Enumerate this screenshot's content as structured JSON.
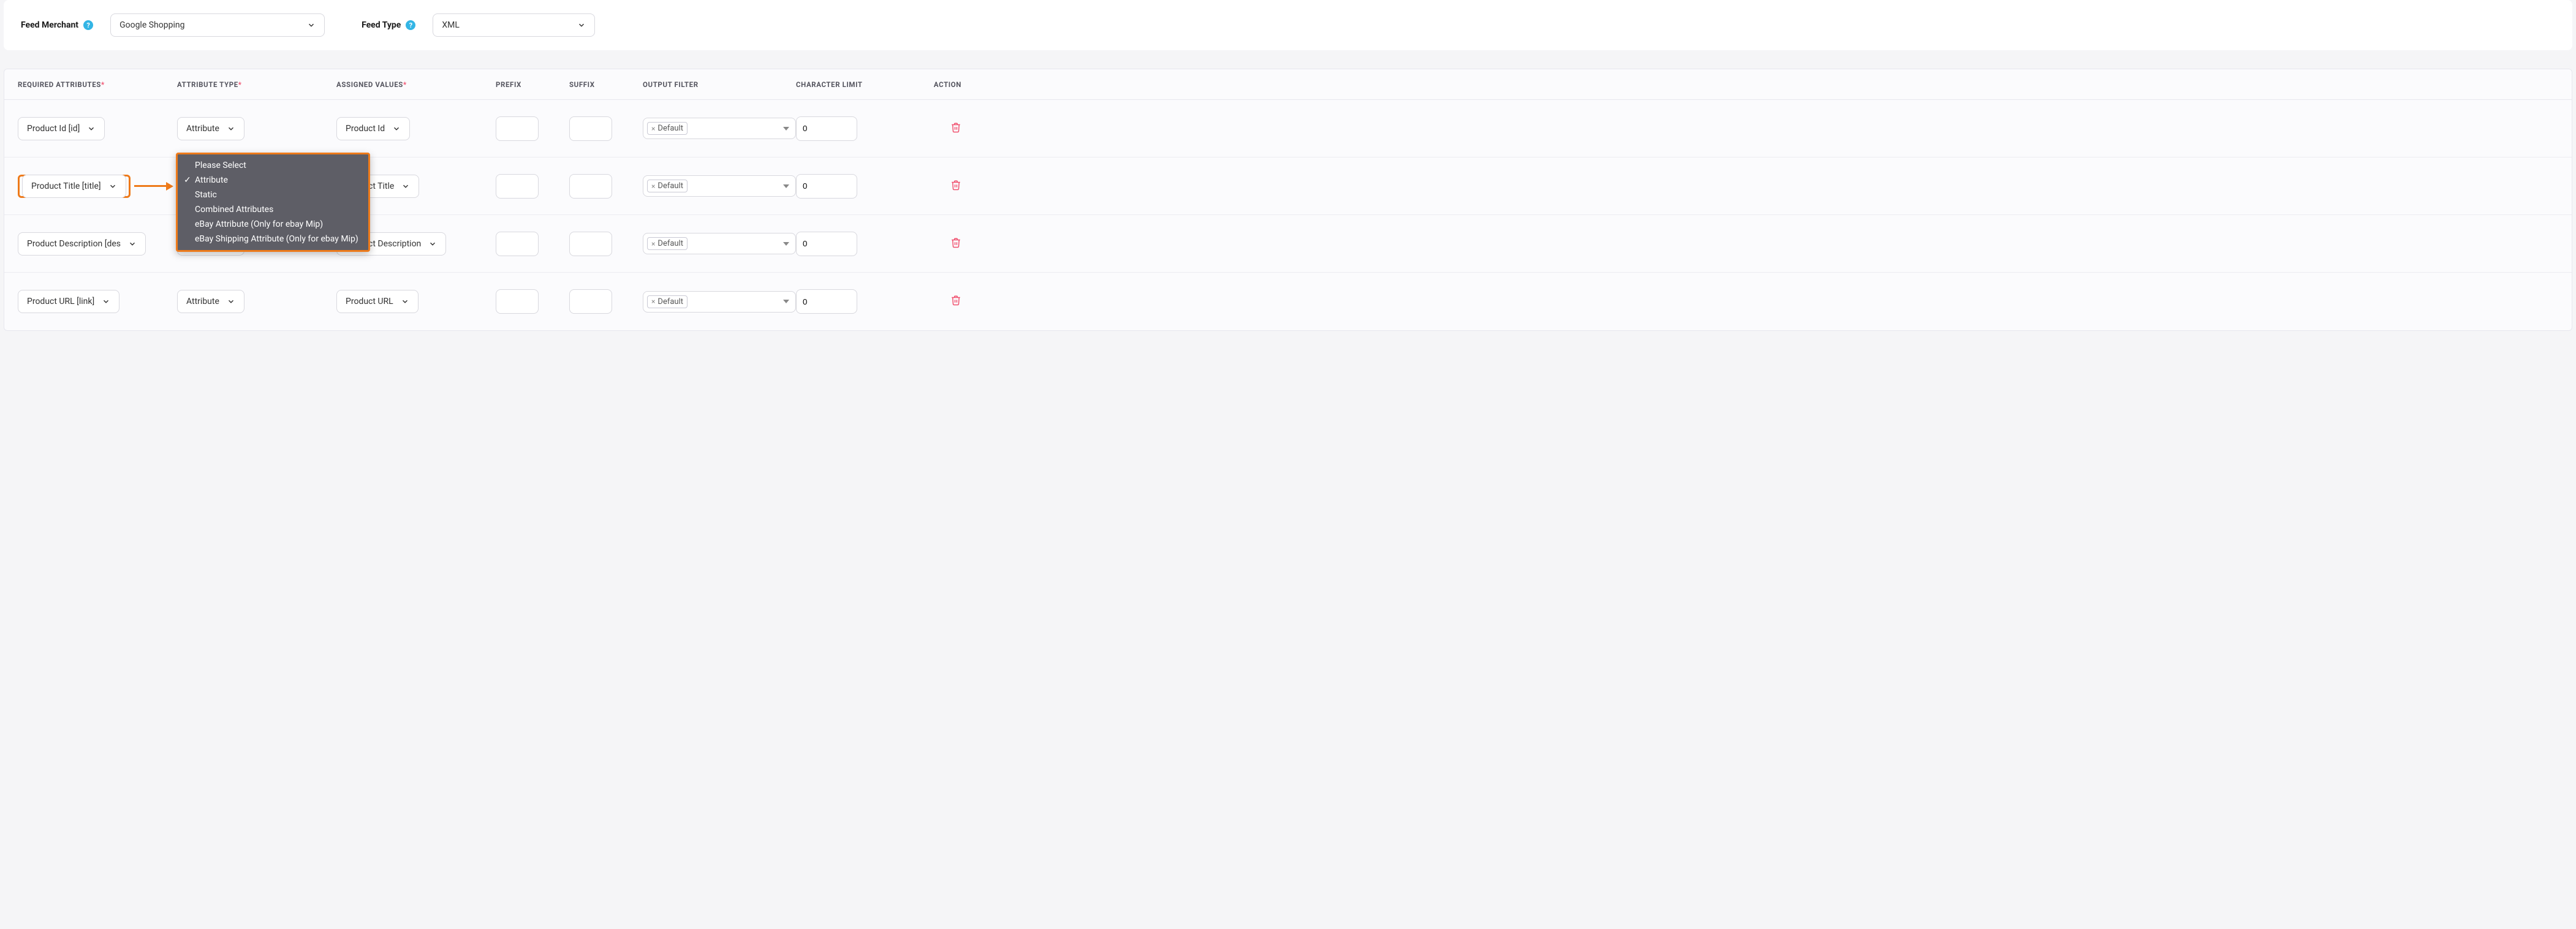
{
  "top": {
    "feed_merchant_label": "Feed Merchant",
    "feed_merchant_value": "Google Shopping",
    "feed_type_label": "Feed Type",
    "feed_type_value": "XML"
  },
  "headers": {
    "required_attributes": "REQUIRED ATTRIBUTES",
    "attribute_type": "ATTRIBUTE TYPE",
    "assigned_values": "ASSIGNED VALUES",
    "prefix": "PREFIX",
    "suffix": "SUFFIX",
    "output_filter": "OUTPUT FILTER",
    "character_limit": "CHARACTER LIMIT",
    "action": "ACTION"
  },
  "rows": [
    {
      "required": "Product Id [id]",
      "attr_type": "Attribute",
      "assigned": "Product Id",
      "prefix": "",
      "suffix": "",
      "filter_tag": "Default",
      "char_limit": "0"
    },
    {
      "required": "Product Title [title]",
      "attr_type": "Attribute",
      "assigned": "Product Title",
      "prefix": "",
      "suffix": "",
      "filter_tag": "Default",
      "char_limit": "0"
    },
    {
      "required": "Product Description [des",
      "attr_type": "Attribute",
      "assigned": "Product Description",
      "prefix": "",
      "suffix": "",
      "filter_tag": "Default",
      "char_limit": "0"
    },
    {
      "required": "Product URL [link]",
      "attr_type": "Attribute",
      "assigned": "Product URL",
      "prefix": "",
      "suffix": "",
      "filter_tag": "Default",
      "char_limit": "0"
    }
  ],
  "dropdown": {
    "options": [
      "Please Select",
      "Attribute",
      "Static",
      "Combined Attributes",
      "eBay Attribute (Only for ebay Mip)",
      "eBay Shipping Attribute (Only for ebay Mip)"
    ],
    "selected_index": 1
  }
}
